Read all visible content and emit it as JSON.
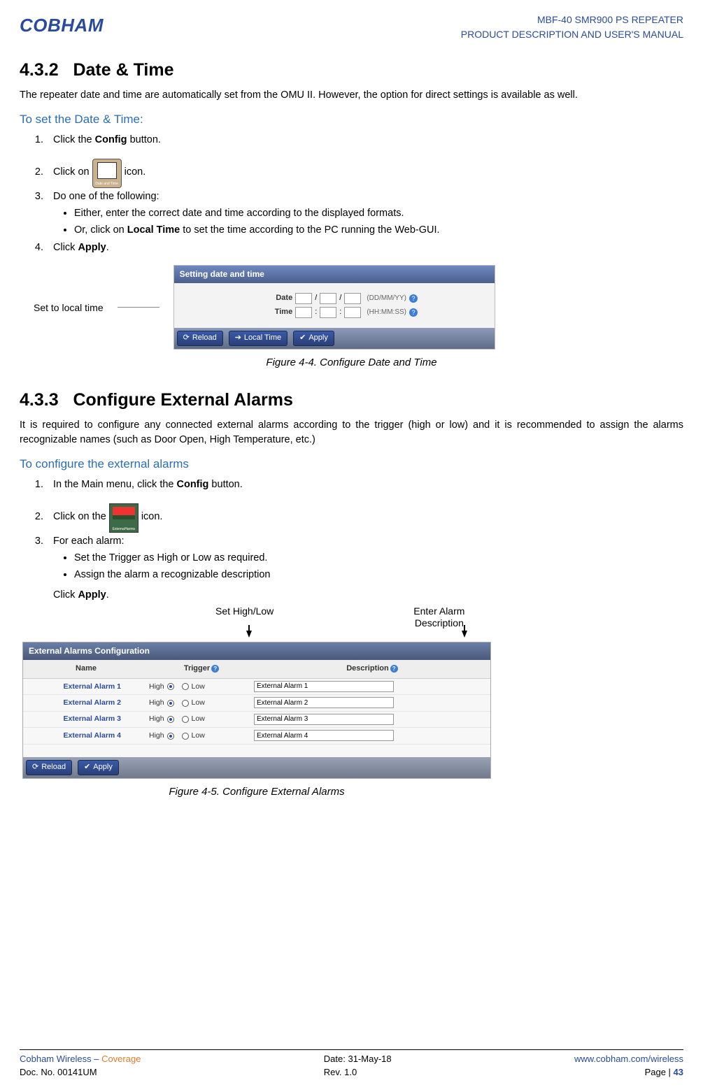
{
  "header": {
    "logo": "COBHAM",
    "line1": "MBF-40 SMR900 PS REPEATER",
    "line2": "PRODUCT DESCRIPTION AND USER'S MANUAL"
  },
  "sec432": {
    "num": "4.3.2",
    "title": "Date & Time",
    "intro": " The repeater date and time are automatically set from the OMU II. However, the option for direct settings is available as well.",
    "sub": "To set the Date & Time:",
    "step1_a": "Click the ",
    "step1_b": "Config",
    "step1_c": " button.",
    "step2_a": "Click on ",
    "step2_b": " icon.",
    "step3": "Do one of the following:",
    "step3_b1": "Either, enter the correct date and time according to the displayed formats.",
    "step3_b2a": "Or, click on ",
    "step3_b2b": "Local Time",
    "step3_b2c": " to set the time according to the PC running the Web-GUI.",
    "step4_a": "Click ",
    "step4_b": "Apply",
    "step4_c": "."
  },
  "fig1": {
    "callout": "Set to local time",
    "panel_title": "Setting date and time",
    "date_label": "Date",
    "date_fmt": "(DD/MM/YY)",
    "time_label": "Time",
    "time_fmt": "(HH:MM:SS)",
    "btn_reload": "Reload",
    "btn_local": "Local Time",
    "btn_apply": "Apply",
    "caption": "Figure 4-4. Configure Date and Time"
  },
  "sec433": {
    "num": "4.3.3",
    "title": "Configure External Alarms",
    "intro": " It is required to configure any connected external alarms according to the trigger (high or low) and it is recommended to assign the alarms recognizable names (such as Door Open, High Temperature, etc.)",
    "sub": "To configure the external alarms",
    "step1_a": "In the Main menu, click the ",
    "step1_b": "Config",
    "step1_c": " button.",
    "step2_a": "Click on the ",
    "step2_b": " icon.",
    "step3": "For each alarm:",
    "step3_b1": "Set the Trigger as High or Low as required.",
    "step3_b2": "Assign the alarm a recognizable description",
    "step4_a": "Click ",
    "step4_b": "Apply",
    "step4_c": "."
  },
  "fig2": {
    "annot1": "Set High/Low",
    "annot2a": "Enter Alarm",
    "annot2b": "Description",
    "panel_title": "External Alarms Configuration",
    "col_name": "Name",
    "col_trigger": "Trigger",
    "col_desc": "Description",
    "high": "High",
    "low": "Low",
    "rows": [
      {
        "name": "External Alarm 1",
        "desc": "External Alarm 1"
      },
      {
        "name": "External Alarm 2",
        "desc": "External Alarm 2"
      },
      {
        "name": "External Alarm 3",
        "desc": "External Alarm 3"
      },
      {
        "name": "External Alarm 4",
        "desc": "External Alarm 4"
      }
    ],
    "btn_reload": "Reload",
    "btn_apply": "Apply",
    "caption": "Figure 4-5.  Configure External Alarms"
  },
  "footer": {
    "l1a": "Cobham Wireless",
    "l1b": " – ",
    "l1c": "Coverage",
    "l2": "Doc. No. 00141UM",
    "c1": "Date: 31-May-18",
    "c2": "Rev. 1.0",
    "r1": "www.cobham.com/wireless",
    "r2a": "Page | ",
    "r2b": "43"
  }
}
